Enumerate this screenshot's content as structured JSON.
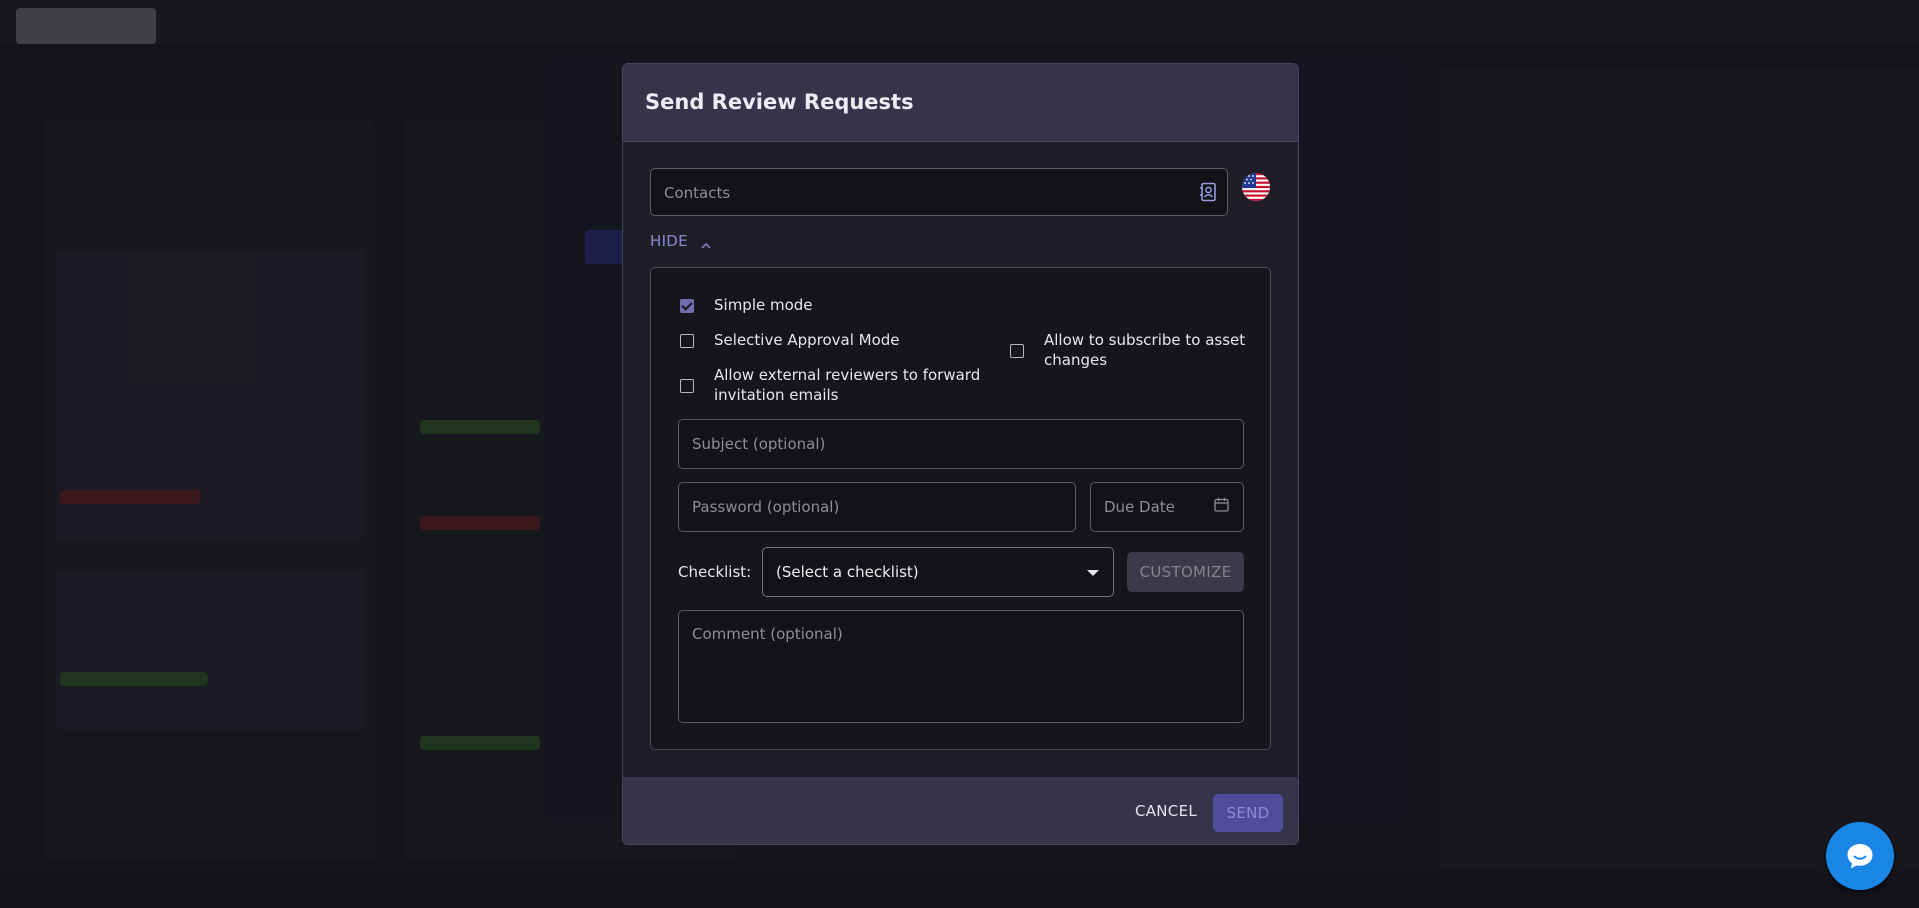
{
  "modal": {
    "title": "Send Review Requests",
    "contacts_placeholder": "Contacts",
    "language_flag": "us-flag-icon",
    "hide_label": "HIDE",
    "options": {
      "simple_mode": {
        "label": "Simple mode",
        "checked": true
      },
      "selective_approval": {
        "label": "Selective Approval Mode",
        "checked": false
      },
      "forward_invitations": {
        "label_line1": "Allow external reviewers to forward",
        "label_line2": "invitation emails",
        "checked": false
      },
      "subscribe_changes": {
        "label_line1": "Allow to subscribe to asset",
        "label_line2": "changes",
        "checked": false
      }
    },
    "subject_placeholder": "Subject (optional)",
    "password_placeholder": "Password (optional)",
    "due_date_placeholder": "Due Date",
    "checklist_label": "Checklist:",
    "checklist_selected": "(Select a checklist)",
    "customize_label": "CUSTOMIZE",
    "comment_placeholder": "Comment (optional)",
    "cancel_label": "CANCEL",
    "send_label": "SEND"
  },
  "colors": {
    "accent": "#4f4d9c",
    "link": "#8a89d4",
    "chat_bubble": "#1a86e6"
  }
}
